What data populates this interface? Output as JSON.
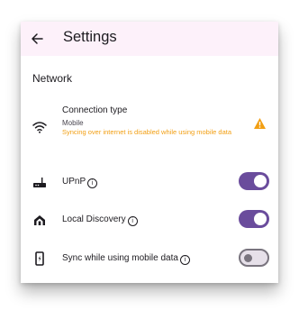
{
  "appbar": {
    "title": "Settings"
  },
  "section": {
    "header": "Network"
  },
  "connection": {
    "title": "Connection type",
    "value": "Mobile",
    "warning": "Syncing over internet is disabled while using mobile data",
    "icon": "wifi-icon",
    "status_icon": "warning-icon"
  },
  "settings": [
    {
      "label": "UPnP",
      "icon": "router-icon",
      "enabled": true
    },
    {
      "label": "Local Discovery",
      "icon": "network-discovery-icon",
      "enabled": true
    },
    {
      "label": "Sync while using mobile data",
      "icon": "mobile-data-icon",
      "enabled": false
    }
  ],
  "colors": {
    "appbar_bg": "#fdf1fa",
    "switch_on": "#6a4c9c",
    "warning": "#f29f13"
  }
}
